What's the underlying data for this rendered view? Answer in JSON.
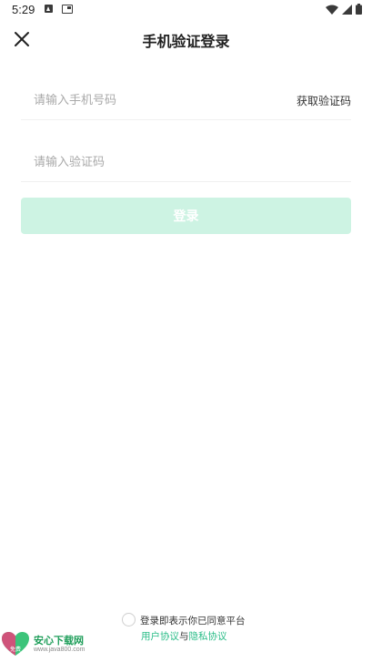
{
  "status_bar": {
    "time": "5:29",
    "icons": [
      "a-notification-icon",
      "screen-card-icon",
      "wifi-icon",
      "signal-icon",
      "battery-icon"
    ]
  },
  "header": {
    "title": "手机验证登录",
    "close_icon": "close-icon"
  },
  "form": {
    "phone_placeholder": "请输入手机号码",
    "phone_value": "",
    "get_code_label": "获取验证码",
    "code_placeholder": "请输入验证码",
    "code_value": "",
    "login_label": "登录"
  },
  "agreement": {
    "text": "登录即表示你已同意平台",
    "user_agreement": "用户协议",
    "connector": "与",
    "privacy_agreement": "隐私协议"
  },
  "watermark": {
    "title": "安心下载网",
    "url": "www.java800.com",
    "badge": "免费"
  },
  "colors": {
    "accent": "#2bbd88",
    "login_button_disabled": "#cdf3e3",
    "placeholder": "#a9a9a9",
    "divider": "#f0f0f0"
  }
}
